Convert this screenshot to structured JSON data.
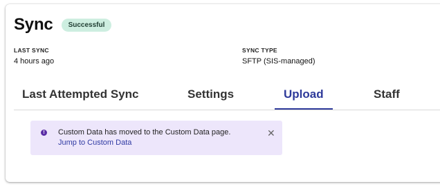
{
  "header": {
    "title": "Sync",
    "status_badge": "Successful"
  },
  "meta": {
    "last_sync": {
      "label": "LAST SYNC",
      "value": "4 hours ago"
    },
    "sync_type": {
      "label": "SYNC TYPE",
      "value": "SFTP (SIS-managed)"
    }
  },
  "tabs": [
    {
      "label": "Last Attempted Sync",
      "active": false
    },
    {
      "label": "Settings",
      "active": false
    },
    {
      "label": "Upload",
      "active": true
    },
    {
      "label": "Staff",
      "active": false
    }
  ],
  "alert": {
    "icon": "info-exclamation-icon",
    "message": "Custom Data has moved to the Custom Data page.",
    "link": "Jump to Custom Data",
    "close_icon": "close-icon"
  },
  "colors": {
    "accent": "#2e3a9a",
    "badge_bg": "#cdeee0",
    "alert_bg": "#ede6fb",
    "alert_icon": "#5b2ea6"
  }
}
